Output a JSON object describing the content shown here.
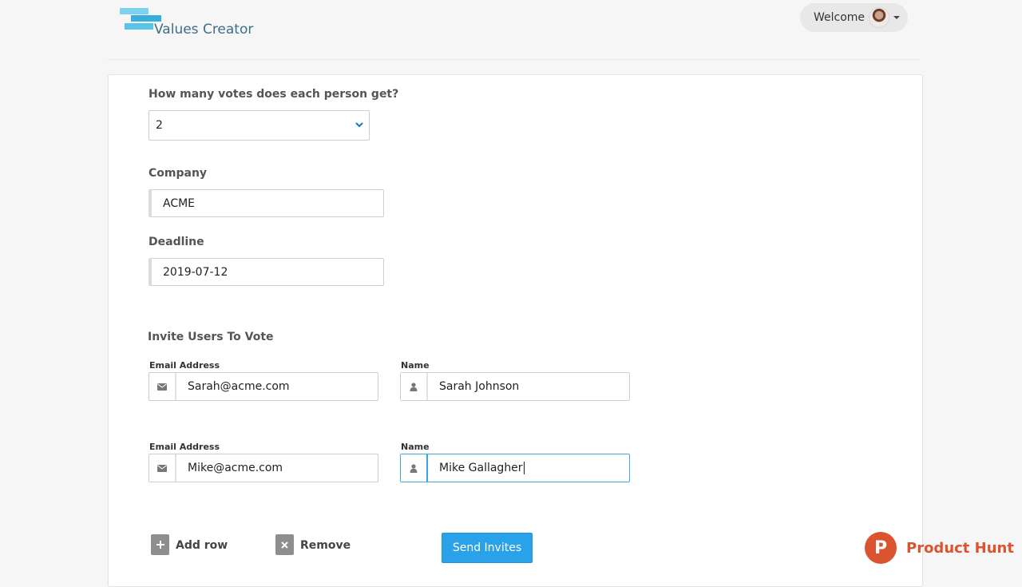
{
  "header": {
    "logo_text": "Values Creator",
    "welcome_label": "Welcome"
  },
  "form": {
    "votes_label": "How many votes does each person get?",
    "votes_value": "2",
    "company_label": "Company",
    "company_value": "ACME",
    "deadline_label": "Deadline",
    "deadline_value": "2019-07-12",
    "invite_heading": "Invite Users To Vote",
    "email_label": "Email Address",
    "name_label": "Name",
    "invitees": [
      {
        "email": "Sarah@acme.com",
        "name": "Sarah Johnson"
      },
      {
        "email": "Mike@acme.com",
        "name": "Mike Gallagher"
      }
    ],
    "add_row_label": "Add row",
    "remove_label": "Remove",
    "send_label": "Send Invites"
  },
  "badge": {
    "letter": "P",
    "text": "Product Hunt"
  },
  "colors": {
    "accent": "#2aa2ea",
    "product_hunt": "#da552f",
    "logo_text": "#3d6f86"
  },
  "icons": {
    "email": "envelope-icon",
    "name": "user-icon",
    "add": "plus-icon",
    "remove": "x-icon",
    "select": "chevron-down-icon"
  }
}
